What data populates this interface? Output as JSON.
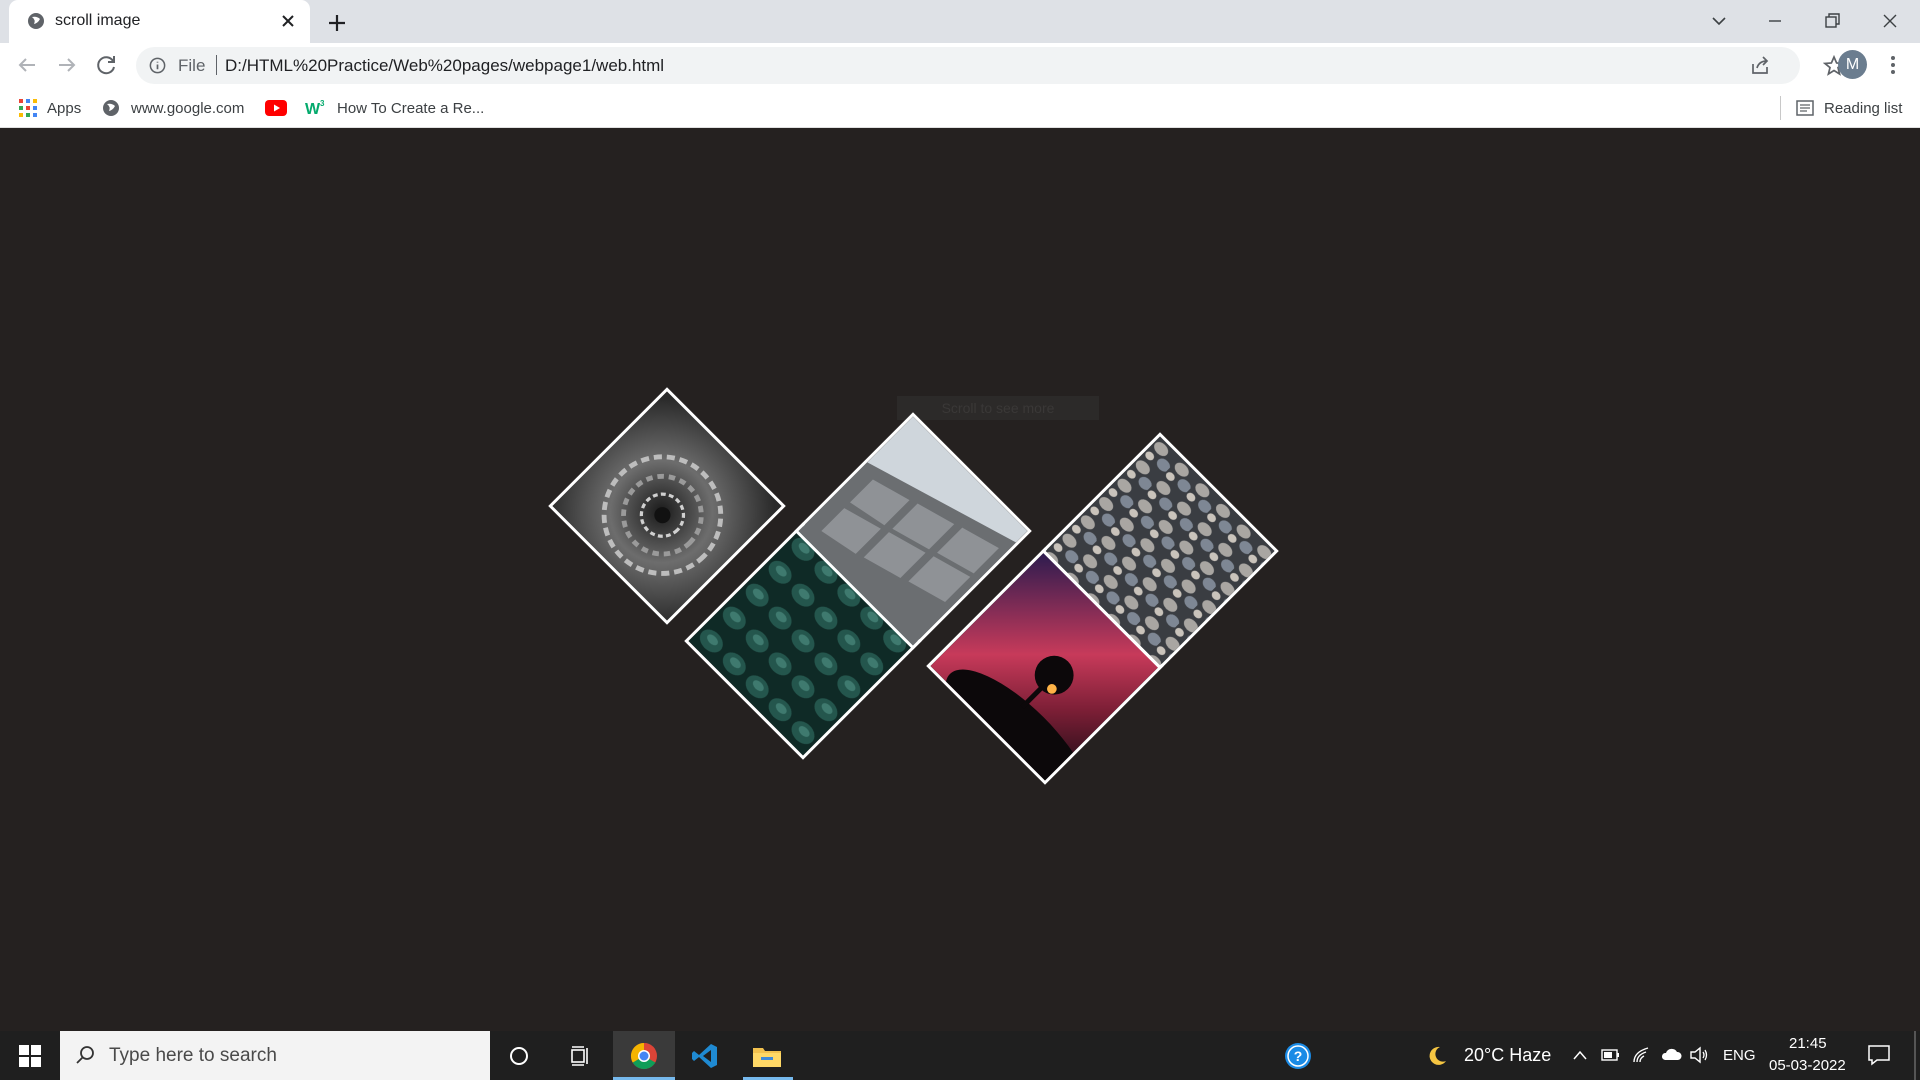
{
  "browser": {
    "tab_title": "scroll image",
    "address_scheme": "File",
    "address_url": "D:/HTML%20Practice/Web%20pages/webpage1/web.html",
    "profile_initial": "M"
  },
  "bookmarks": {
    "items": [
      {
        "label": "Apps",
        "icon": "apps-grid-icon"
      },
      {
        "label": "www.google.com",
        "icon": "globe-icon"
      },
      {
        "label": "",
        "icon": "youtube-icon"
      },
      {
        "label": "How To Create a Re...",
        "icon": "w3schools-icon"
      }
    ],
    "reading_list": "Reading list"
  },
  "page": {
    "hint_text": "Scroll to see more",
    "tiles": [
      {
        "name": "tile-silver-spiral",
        "subject": "abstract silver spiral"
      },
      {
        "name": "tile-green-leaves",
        "subject": "dark green succulent leaves"
      },
      {
        "name": "tile-concrete-building",
        "subject": "grey concrete building facade"
      },
      {
        "name": "tile-sunset-tree",
        "subject": "tree silhouette at red sunset"
      },
      {
        "name": "tile-pebbles",
        "subject": "grey pebbles"
      }
    ]
  },
  "taskbar": {
    "search_placeholder": "Type here to search",
    "weather": "20°C  Haze",
    "language": "ENG",
    "time": "21:45",
    "date": "05-03-2022"
  },
  "colors": {
    "page_background": "#252120",
    "tab_strip": "#dee1e6",
    "taskbar": "#1f1f1f",
    "accent": "#76b9ed"
  }
}
